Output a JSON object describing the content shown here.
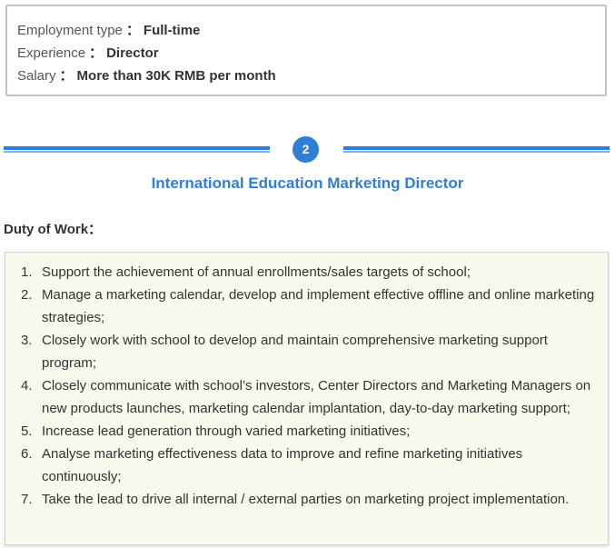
{
  "info": {
    "rows": [
      {
        "label": "Employment type",
        "sep": "：",
        "value": "Full-time"
      },
      {
        "label": "Experience",
        "sep": "：",
        "value": "Director"
      },
      {
        "label": "Salary",
        "sep": "：",
        "value": "More than 30K RMB per month"
      }
    ]
  },
  "section": {
    "number": "2",
    "title": "International Education Marketing Director"
  },
  "duty": {
    "label": "Duty of Work：",
    "items": [
      {
        "num": "1.",
        "text": "Support the achievement of annual enrollments/sales targets of school;"
      },
      {
        "num": "2.",
        "text": "Manage a marketing calendar, develop and implement effective offline and online marketing strategies;"
      },
      {
        "num": "3.",
        "text": "Closely work with school to develop and maintain comprehensive marketing support program;"
      },
      {
        "num": "4.",
        "text": "Closely communicate with school’s investors, Center Directors and Marketing Managers on new products launches, marketing calendar implantation, day-to-day marketing support;"
      },
      {
        "num": "5.",
        "text": "Increase lead generation through varied marketing initiatives;"
      },
      {
        "num": "6.",
        "text": "Analyse marketing effectiveness data to improve and refine marketing initiatives continuously;"
      },
      {
        "num": "7.",
        "text": "Take the lead to drive all internal / external parties on marketing project implementation."
      }
    ]
  },
  "colors": {
    "accent": "#2f7fd6",
    "box_border": "#cdbdd3",
    "duty_bg": "#f8f8ec"
  }
}
